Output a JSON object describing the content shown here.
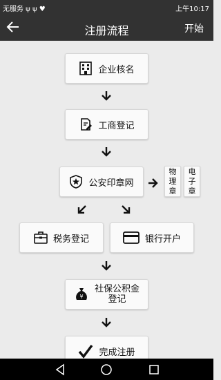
{
  "status": {
    "left": "无服务 ψ ψ ♥",
    "right": "上午10:17"
  },
  "header": {
    "title": "注册流程",
    "start_label": "开始"
  },
  "steps": {
    "name_check": "企业核名",
    "business_registration": "工商登记",
    "police_seal": "公安印章网",
    "physical_seal": [
      "物",
      "理",
      "章"
    ],
    "electronic_seal": [
      "电",
      "子",
      "章"
    ],
    "tax_registration": "税务登记",
    "bank_account": "银行开户",
    "social_security_line1": "社保公积金",
    "social_security_line2": "登记",
    "complete": "完成注册"
  },
  "colors": {
    "bar": "#323232",
    "background": "#ebebeb",
    "card": "#fafafa"
  }
}
